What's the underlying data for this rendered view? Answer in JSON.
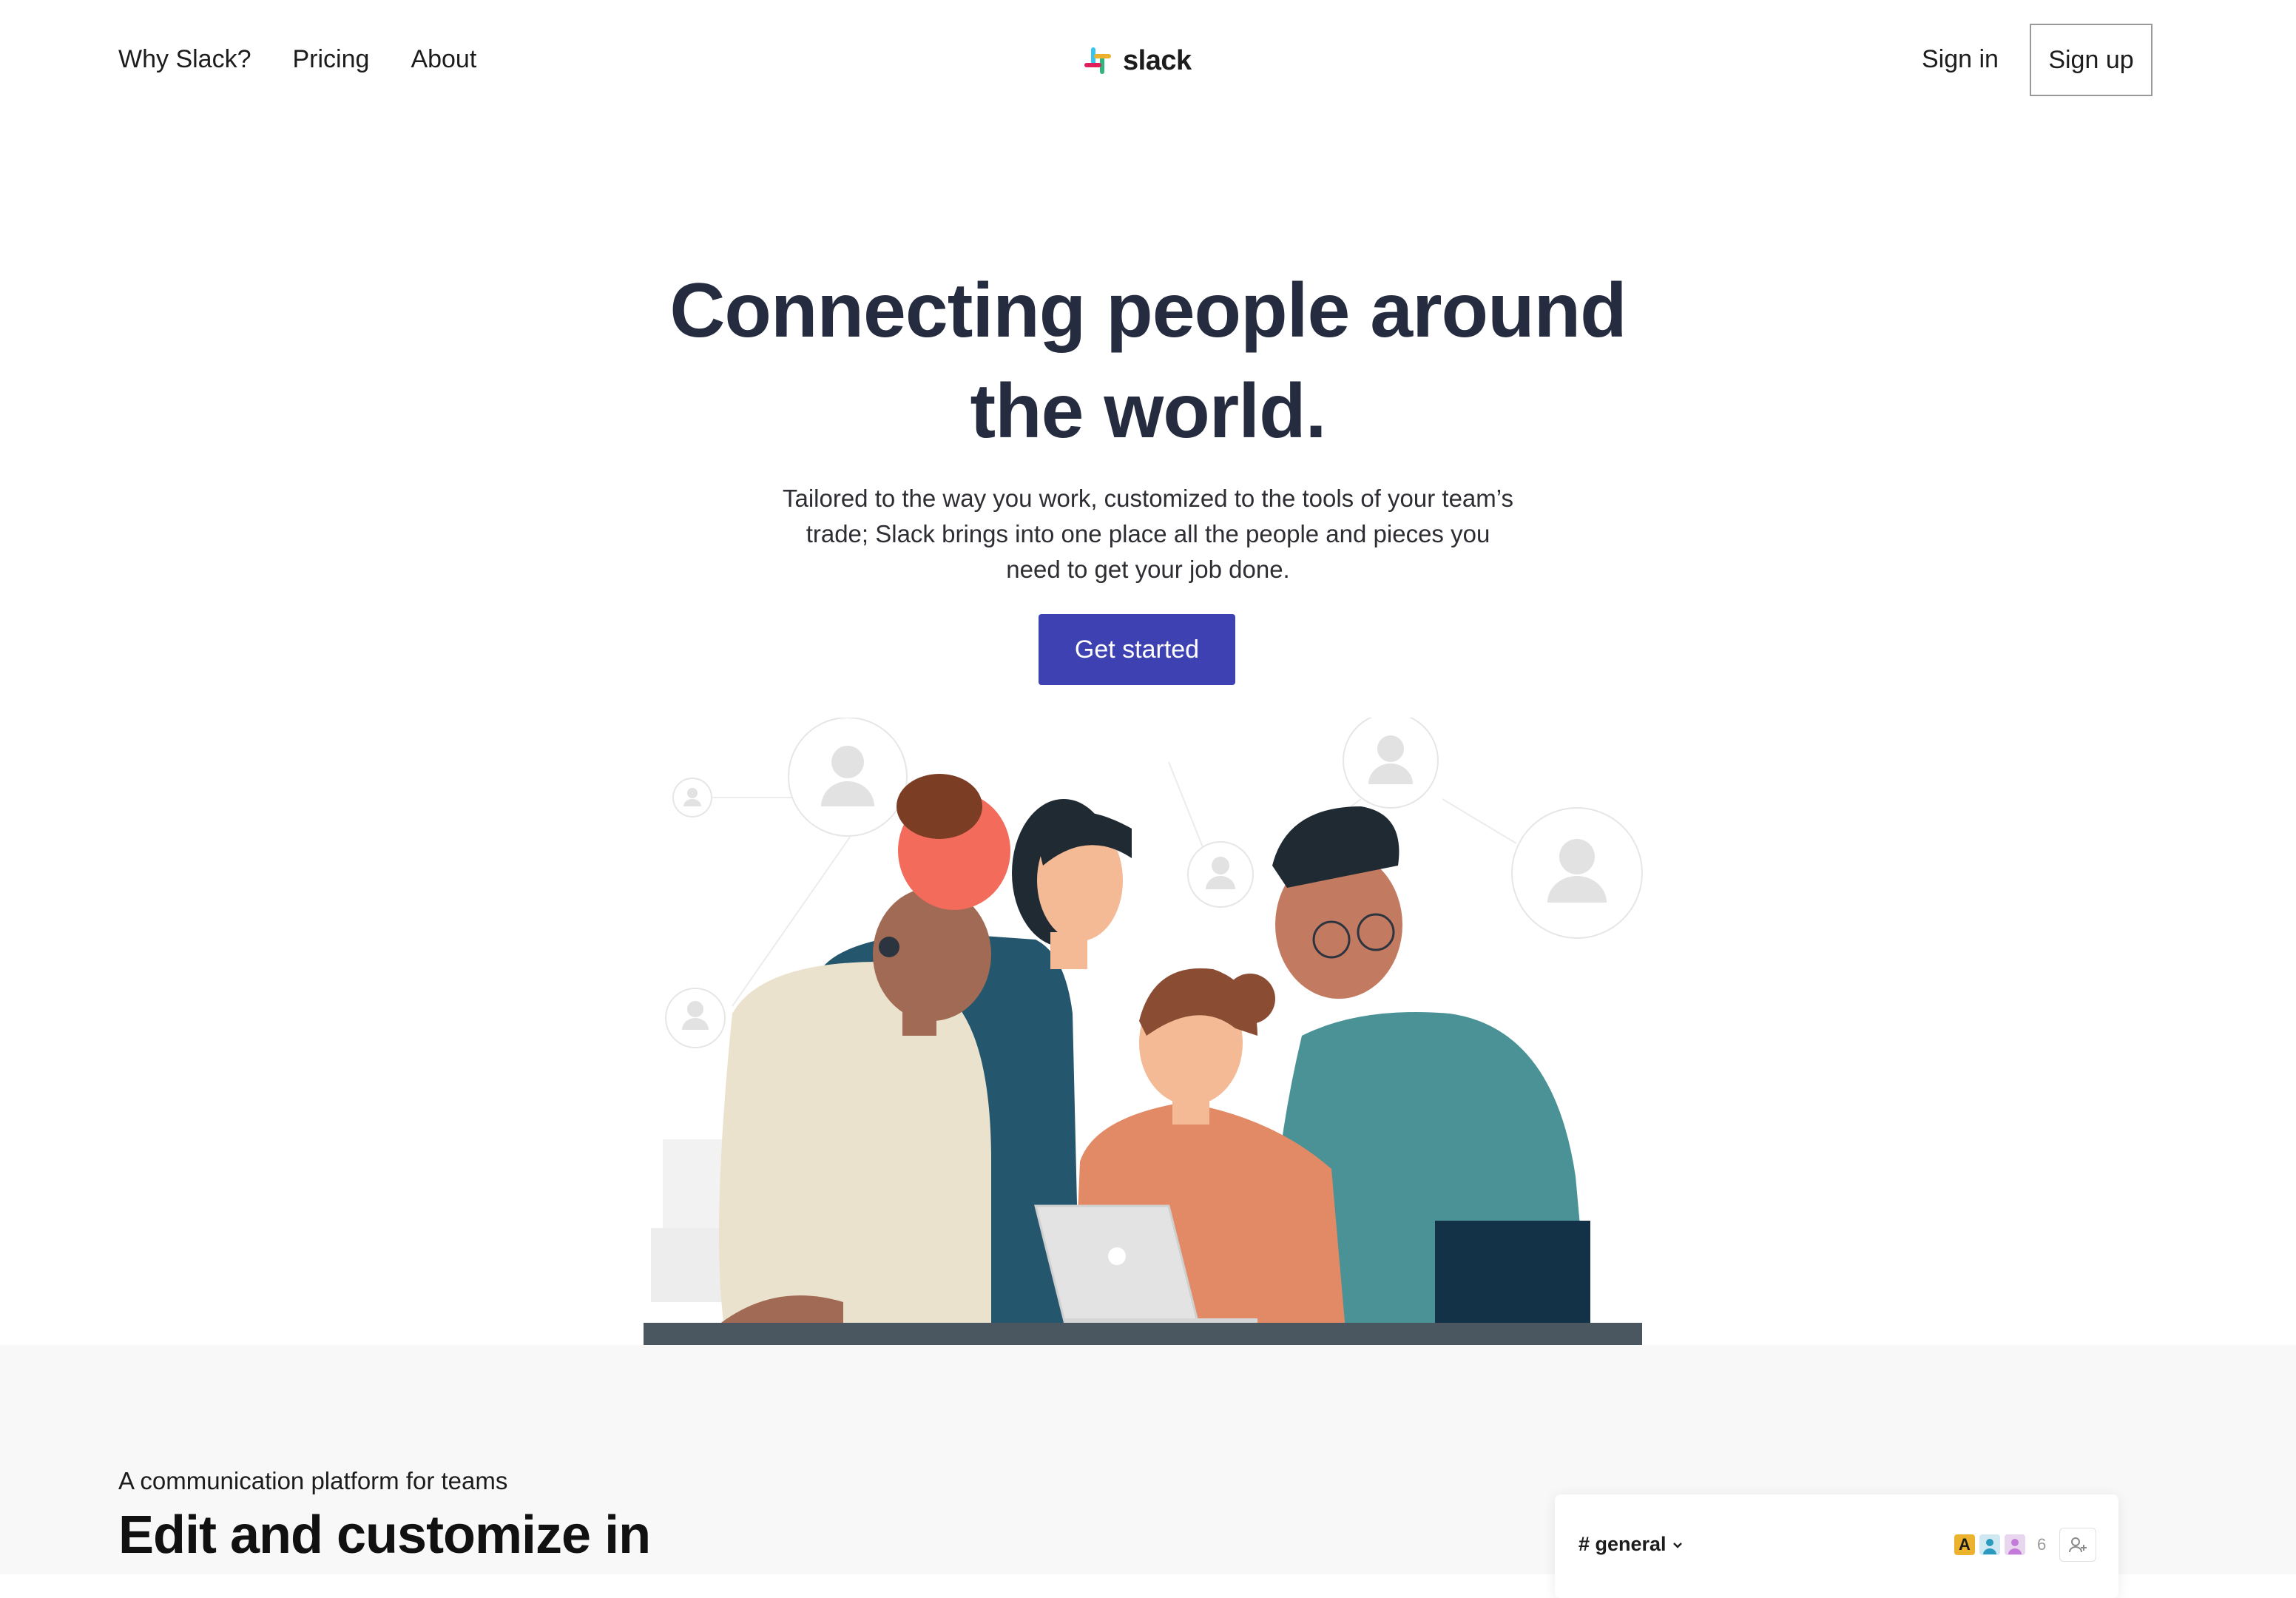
{
  "header": {
    "nav": [
      {
        "label": "Why Slack?"
      },
      {
        "label": "Pricing"
      },
      {
        "label": "About"
      }
    ],
    "brand": "slack",
    "sign_in": "Sign in",
    "sign_up": "Sign up"
  },
  "hero": {
    "title_line1": "Connecting people around",
    "title_line2": "the world.",
    "subtitle": "Tailored to the way you work, customized to the tools of your team’s trade; Slack brings into one place all the people and pieces you need to get your job done.",
    "cta": "Get started"
  },
  "features": {
    "eyebrow": "A communication platform for teams",
    "title": "Edit and customize in",
    "preview": {
      "channel": "# general",
      "avatar_letter": "A",
      "member_count": "6"
    }
  },
  "colors": {
    "primary": "#3d41b2",
    "heading": "#262c3f",
    "section_bg": "#f8f8f8",
    "slack_yellow": "#ecb22e"
  },
  "icons": [
    "slack-logo-icon",
    "chevron-down-icon",
    "user-avatar-icon",
    "add-user-icon"
  ]
}
